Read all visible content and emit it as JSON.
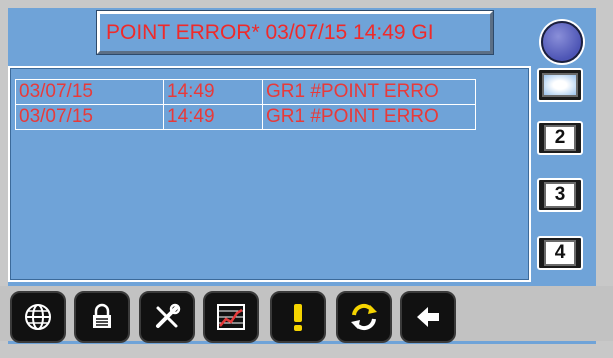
{
  "status_banner": {
    "text": "POINT ERROR*  03/07/15  14:49  GI"
  },
  "alarm_list": {
    "rows": [
      {
        "date": "03/07/15",
        "time": "14:49",
        "message": "GR1 #POINT ERRO"
      },
      {
        "date": "03/07/15",
        "time": "14:49",
        "message": "GR1 #POINT ERRO"
      }
    ]
  },
  "side_buttons": [
    {
      "label": ""
    },
    {
      "label": "2"
    },
    {
      "label": "3"
    },
    {
      "label": "4"
    }
  ],
  "toolbar": {
    "icons": [
      "globe-icon",
      "lock-icon",
      "tools-icon",
      "chart-icon",
      "alert-icon",
      "refresh-icon",
      "back-arrow-icon"
    ]
  },
  "colors": {
    "screen": "#6fa3d8",
    "text_red": "#ef2a2a",
    "button_black": "#111111",
    "alert_yellow": "#f5d400"
  }
}
